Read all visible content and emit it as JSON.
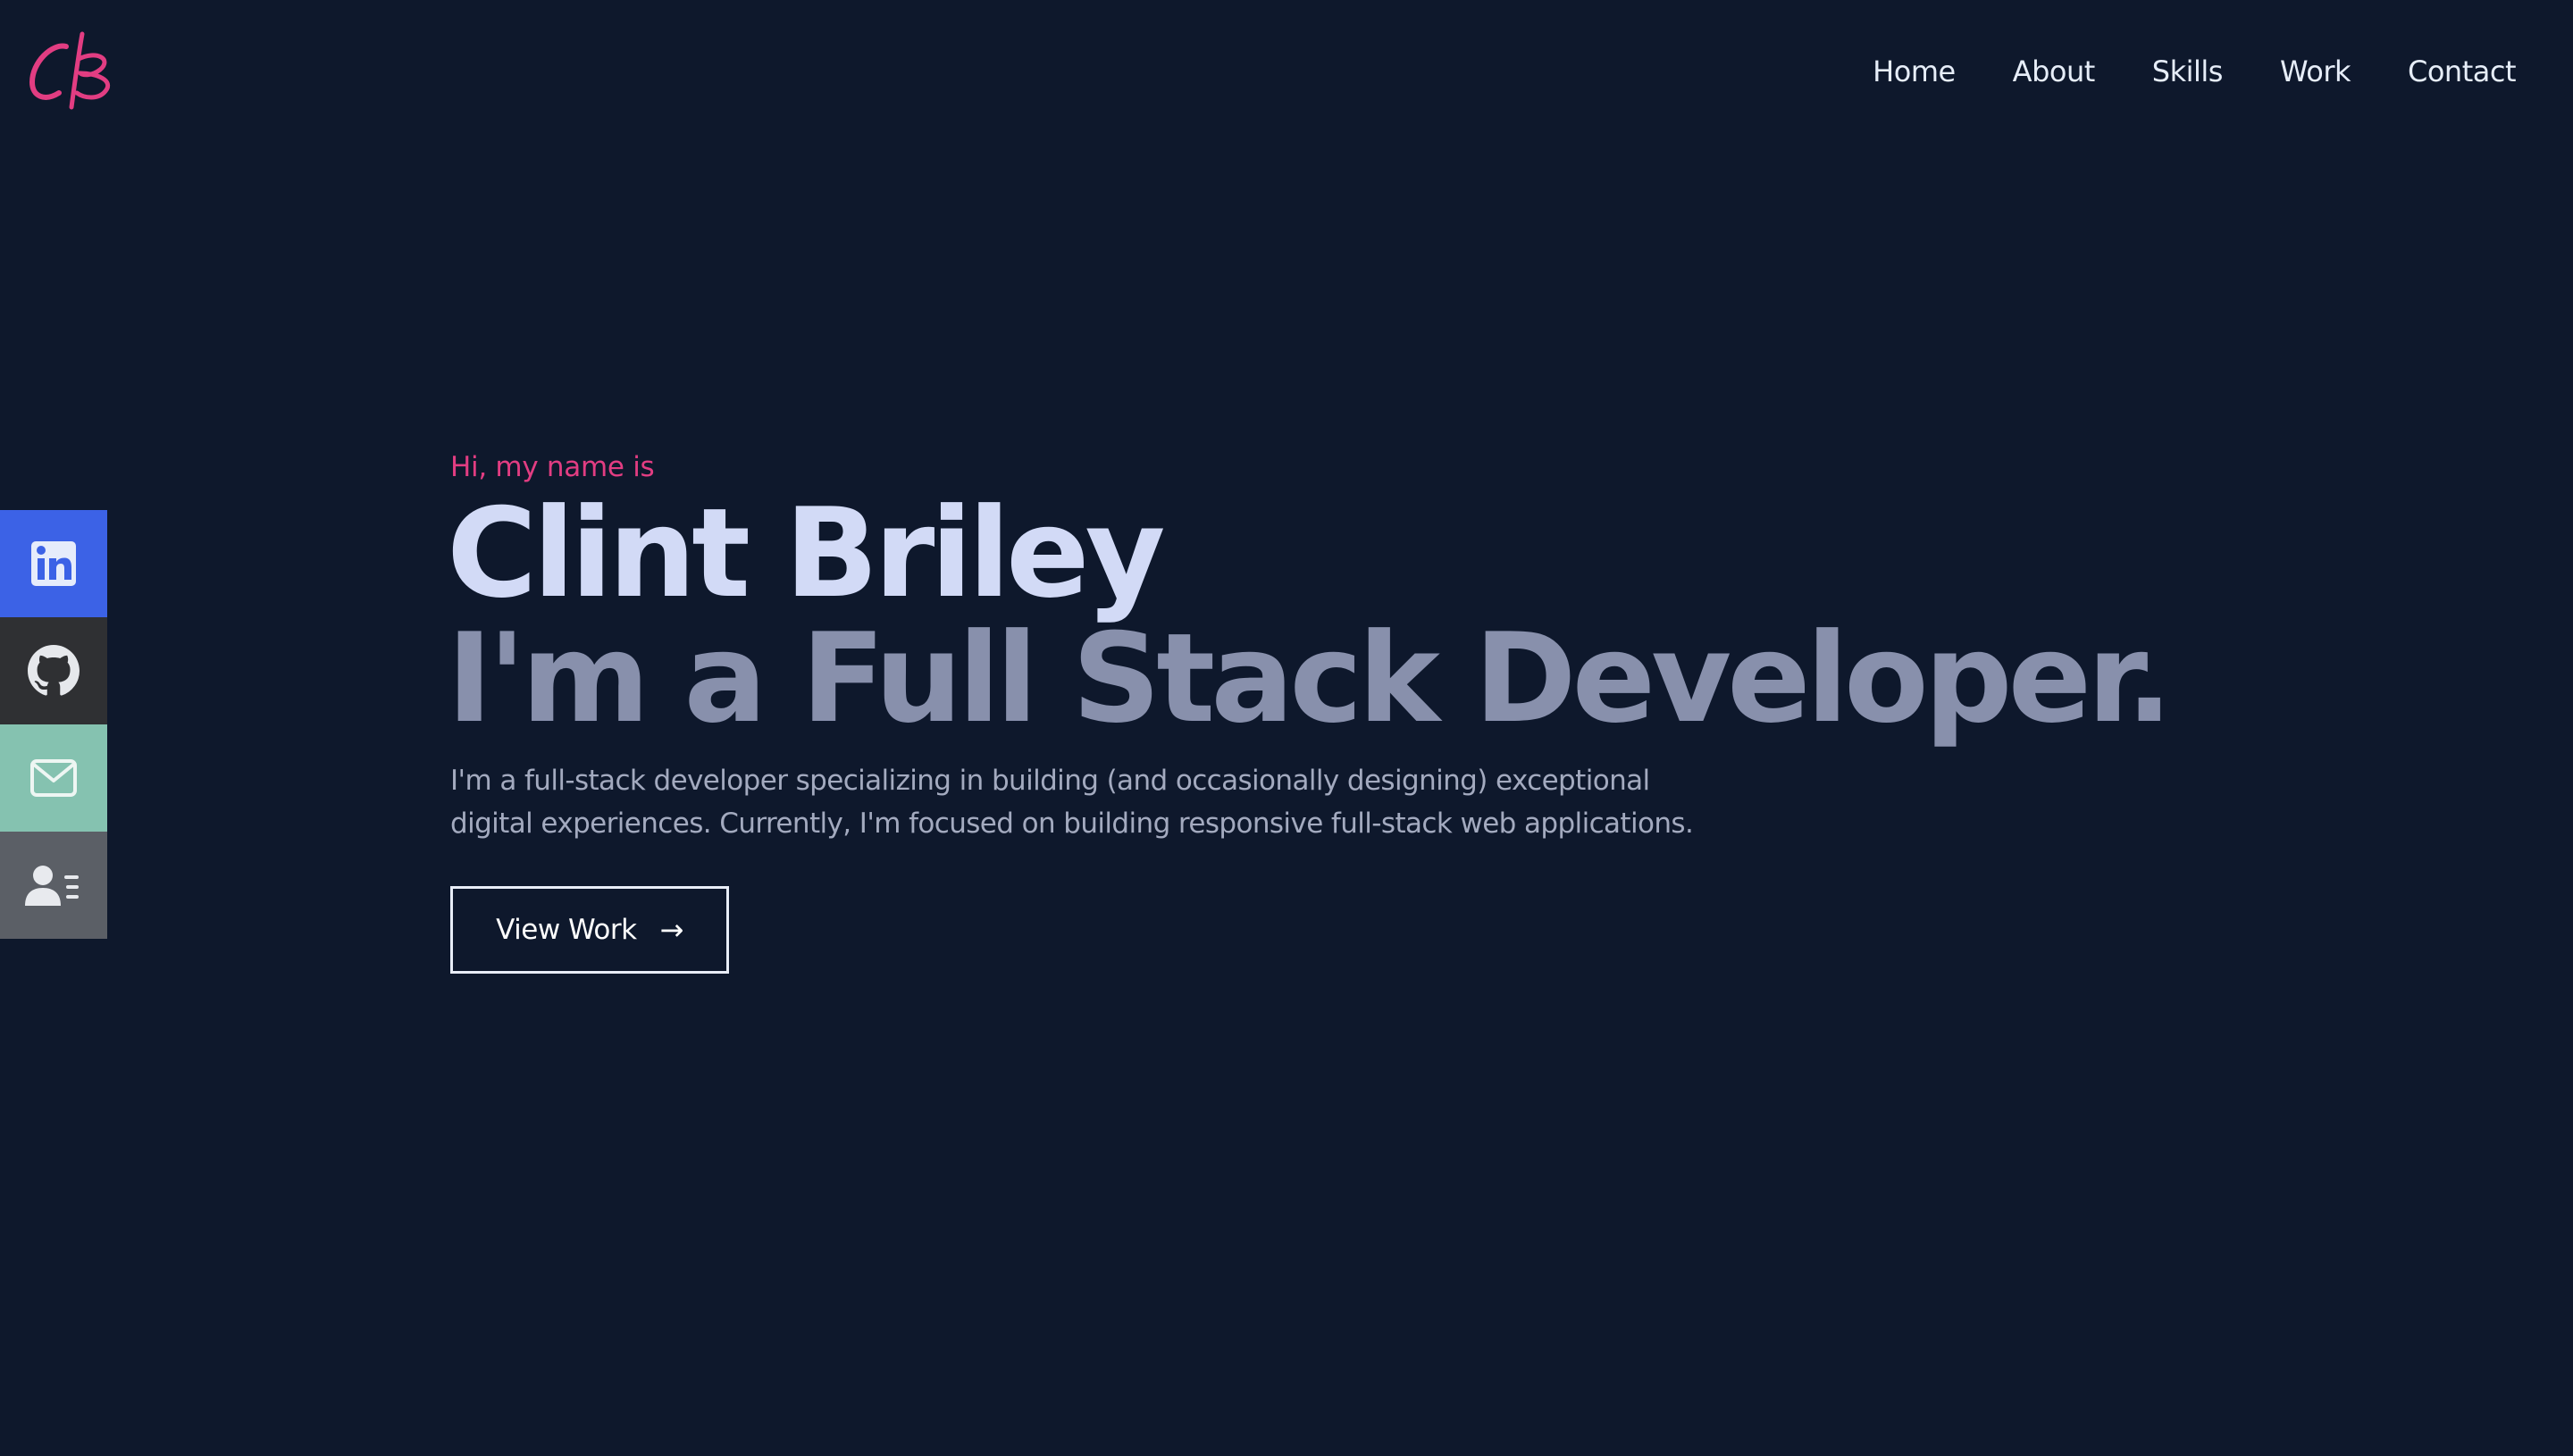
{
  "logo": {
    "text": "CB",
    "color": "#e23d82"
  },
  "nav": {
    "items": [
      "Home",
      "About",
      "Skills",
      "Work",
      "Contact"
    ]
  },
  "social": [
    {
      "name": "linkedin",
      "icon": "linkedin-icon",
      "color": "#3c62e6"
    },
    {
      "name": "github",
      "icon": "github-icon",
      "color": "#2f3033"
    },
    {
      "name": "email",
      "icon": "mail-icon",
      "color": "#85c2b0"
    },
    {
      "name": "resume",
      "icon": "contact-card-icon",
      "color": "#5b5f66"
    }
  ],
  "hero": {
    "greeting": "Hi, my name is",
    "name": "Clint Briley",
    "tagline": "I'm a Full Stack Developer.",
    "bio": "I'm a full-stack developer specializing in building (and occasionally designing) exceptional digital experiences. Currently, I'm focused on building responsive full-stack web applications.",
    "cta_label": "View Work",
    "cta_arrow": "→"
  },
  "colors": {
    "background": "#0e182c",
    "accent": "#e23d82",
    "name": "#d2daf6",
    "tagline": "#8890ac",
    "body": "#a3aabf"
  }
}
